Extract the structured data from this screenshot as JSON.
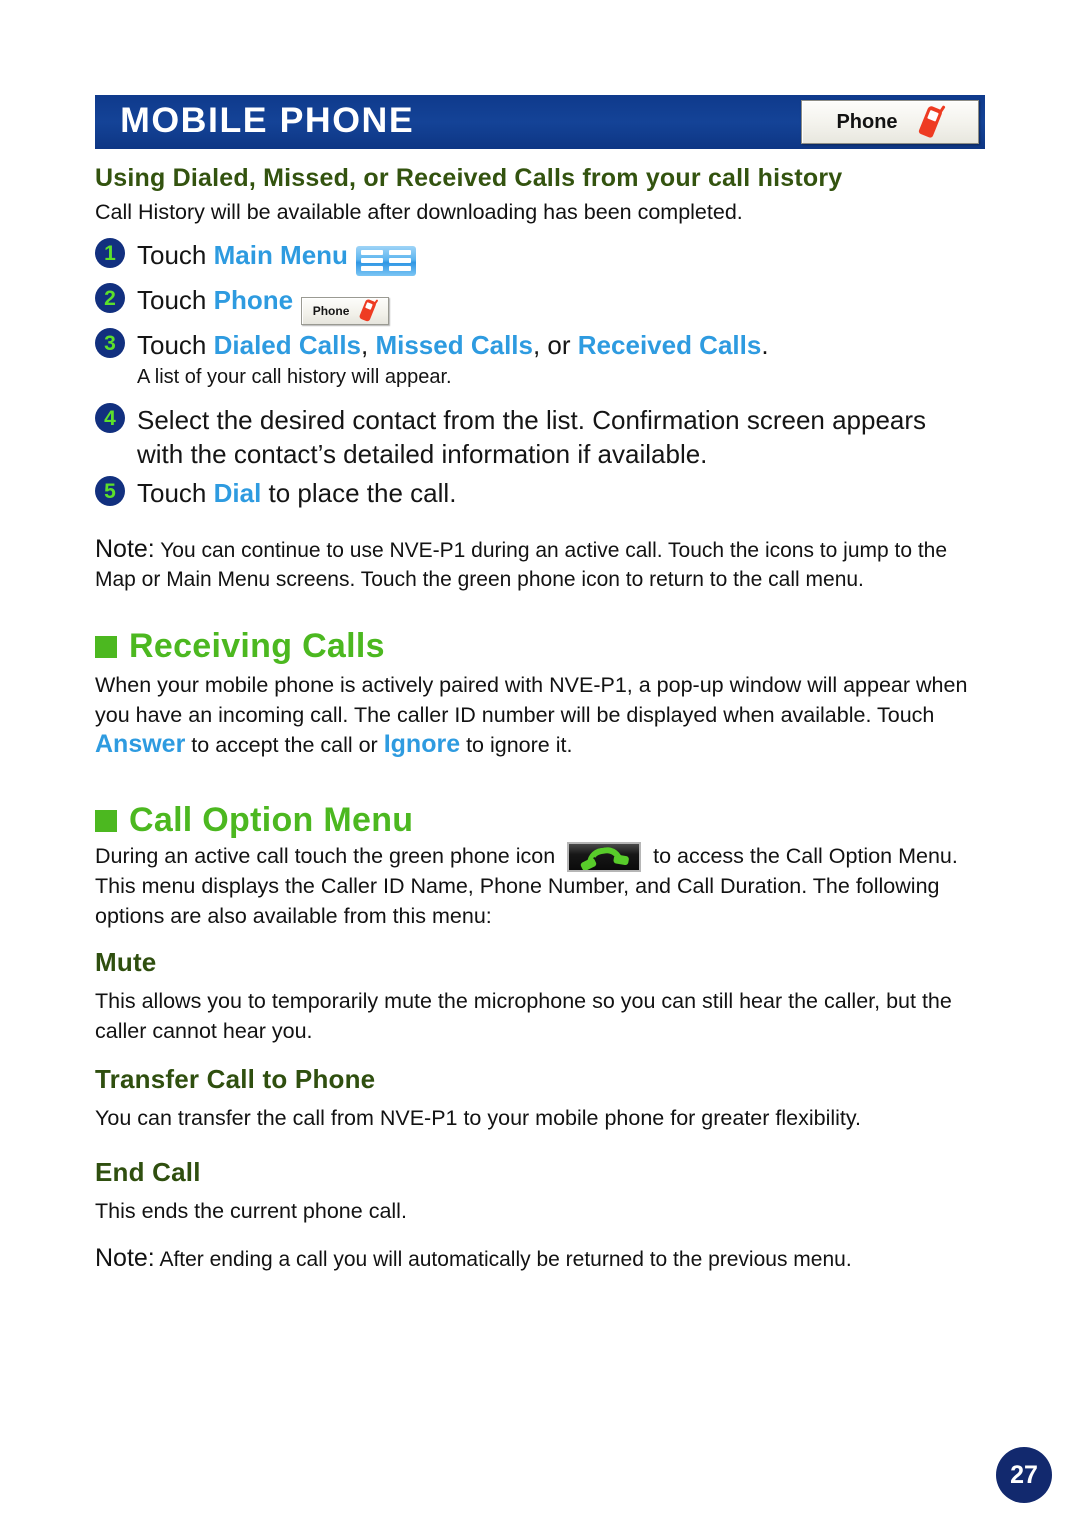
{
  "header": {
    "title": "MOBILE PHONE",
    "chip_label": "Phone",
    "chip_icon": "red-mobile-phone-icon",
    "bar_color": "#123d8f"
  },
  "section_intro": {
    "heading": "Using Dialed, Missed, or Received Calls from your call history",
    "heading_color": "#33530f",
    "lead": "Call History will be available after downloading has been completed."
  },
  "steps": [
    {
      "number": "1",
      "pre": "Touch ",
      "accent": "Main Menu",
      "post": "",
      "icon": "main-menu-grid-icon",
      "sub": ""
    },
    {
      "number": "2",
      "pre": "Touch ",
      "accent": "Phone",
      "post": "",
      "icon": "phone-chip-icon",
      "chip_label": "Phone",
      "sub": ""
    },
    {
      "number": "3",
      "pre": "Touch ",
      "accent": "Dialed Calls",
      "mid1": ", ",
      "accent2": "Missed Calls",
      "mid2": ", or ",
      "accent3": "Received Calls",
      "post": ".",
      "sub": "A list of your call history will appear."
    },
    {
      "number": "4",
      "text": "Select the desired contact from the list. Confirmation screen appears with the contact’s detailed information if available.",
      "sub": ""
    },
    {
      "number": "5",
      "pre": "Touch ",
      "accent": "Dial",
      "post": " to place the call.",
      "sub": ""
    }
  ],
  "note_1": {
    "label": "Note:",
    "text": " You can continue to use NVE-P1 during an active call. Touch the icons to jump to the Map or Main Menu screens. Touch the green phone icon to return to the call menu."
  },
  "receiving_calls": {
    "heading": "Receiving Calls",
    "heading_color": "#4cb820",
    "p_part1": "When your mobile phone is actively paired with NVE-P1, a pop-up window will appear when you have an incoming call. The caller ID number will be displayed when available. Touch ",
    "answer": "Answer",
    "p_part2": " to accept the call or ",
    "ignore": "Ignore",
    "p_part3": " to ignore it."
  },
  "call_option_menu": {
    "heading": "Call Option Menu",
    "heading_color": "#4cb820",
    "p_part1": "During an active call touch the green phone icon ",
    "icon": "green-handset-icon",
    "p_part2": " to access the Call Option Menu. This menu displays the Caller ID Name, Phone Number, and Call Duration. The following options are also available from this menu:",
    "options": [
      {
        "title": "Mute",
        "body": "This allows you to temporarily mute the microphone so you can still hear the caller, but the caller cannot hear you."
      },
      {
        "title": "Transfer Call to Phone",
        "body": "You can transfer the call from NVE-P1 to your mobile phone for greater flexibility."
      },
      {
        "title": "End Call",
        "body": "This ends the current phone call."
      }
    ]
  },
  "note_2": {
    "label": "Note:",
    "text": " After ending a call you will automatically be returned to the previous menu."
  },
  "footer": {
    "page_number": "27",
    "badge_color": "#12296e"
  },
  "accent_color": "#2e9be0"
}
